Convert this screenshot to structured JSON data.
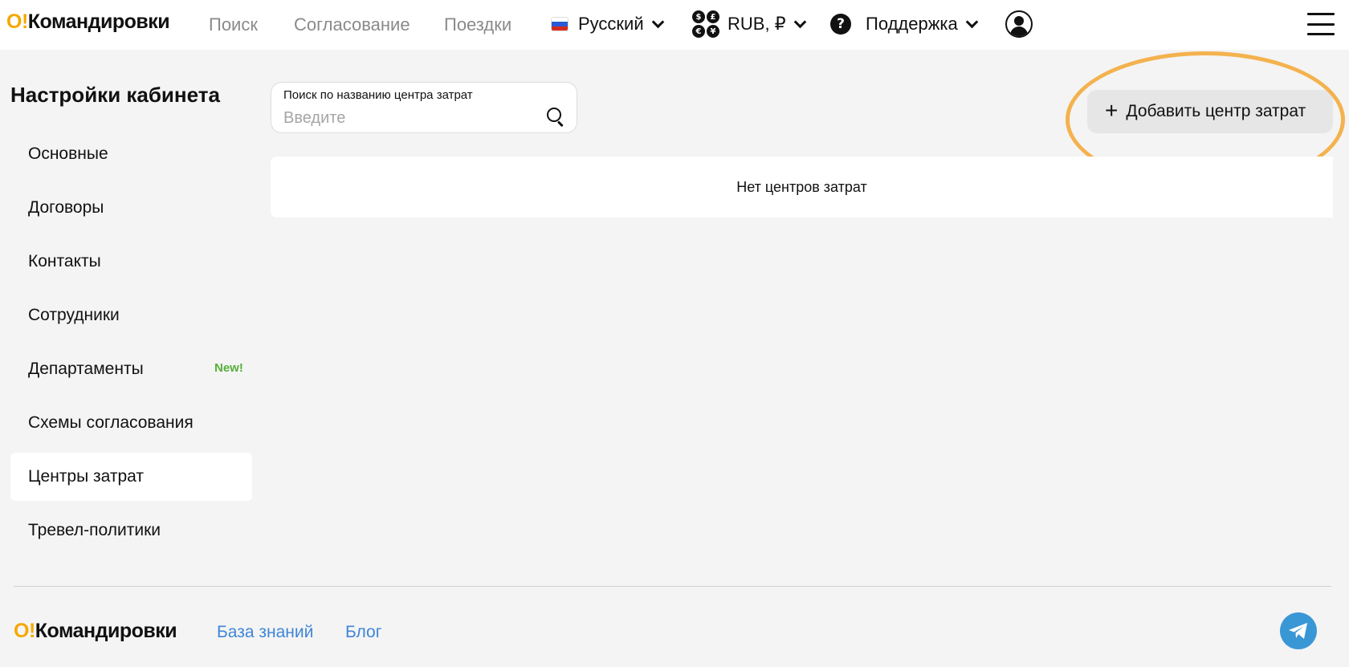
{
  "header": {
    "logo_mark": "О!",
    "logo_text": "Командировки",
    "nav": [
      "Поиск",
      "Согласование",
      "Поездки"
    ],
    "language": "Русский",
    "currency": "RUB, ₽",
    "currency_symbols": [
      "$",
      "£",
      "€",
      "¥"
    ],
    "support": "Поддержка",
    "help_glyph": "?"
  },
  "sidebar": {
    "title": "Настройки кабинета",
    "items": [
      {
        "label": "Основные"
      },
      {
        "label": "Договоры"
      },
      {
        "label": "Контакты"
      },
      {
        "label": "Сотрудники"
      },
      {
        "label": "Департаменты",
        "badge": "New!"
      },
      {
        "label": "Схемы согласования"
      },
      {
        "label": "Центры затрат",
        "active": true
      },
      {
        "label": "Тревел-политики"
      }
    ]
  },
  "main": {
    "search": {
      "label": "Поиск по названию центра затрат",
      "placeholder": "Введите",
      "value": ""
    },
    "add_button": {
      "plus": "+",
      "label": "Добавить центр затрат"
    },
    "empty_message": "Нет центров затрат"
  },
  "footer": {
    "logo_mark": "О!",
    "logo_text": "Командировки",
    "links": [
      "База знаний",
      "Блог"
    ]
  },
  "colors": {
    "accent_logo": "#f6a800",
    "highlight_ring": "#f4b24e",
    "link": "#3f86d6",
    "badge_new": "#55b03a",
    "telegram": "#3a97d6"
  },
  "icons": [
    "search-icon",
    "chevron-down-icon",
    "flag-ru-icon",
    "currency-icon",
    "help-icon",
    "avatar-icon",
    "menu-icon",
    "plus-icon",
    "telegram-icon"
  ]
}
